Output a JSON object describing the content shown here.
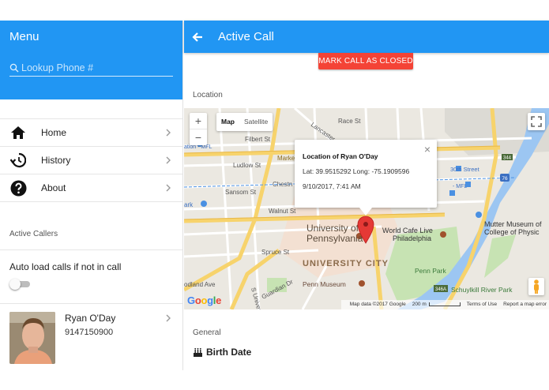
{
  "sidebar": {
    "title": "Menu",
    "search": {
      "placeholder": "Lookup Phone #",
      "value": ""
    },
    "nav": [
      {
        "label": "Home",
        "icon": "home-icon"
      },
      {
        "label": "History",
        "icon": "history-icon"
      },
      {
        "label": "About",
        "icon": "help-icon"
      }
    ],
    "active_callers_label": "Active Callers",
    "auto_load_label": "Auto load calls if not in call",
    "auto_load_enabled": false,
    "callers": [
      {
        "name": "Ryan O'Day",
        "phone": "9147150900"
      }
    ]
  },
  "main": {
    "back_icon": "arrow-left-icon",
    "title": "Active Call",
    "close_button": "MARK CALL AS CLOSED",
    "location_label": "Location",
    "map": {
      "map_button": "Map",
      "satellite_button": "Satellite",
      "zoom_in": "+",
      "zoom_out": "−",
      "info": {
        "title": "Location of Ryan O'Day",
        "coords": "Lat: 39.9515292 Long: -75.1909596",
        "datetime": "9/10/2017, 7:41 AM",
        "close": "×"
      },
      "labels": {
        "filbert": "Filbert St",
        "ludlow": "Ludlow St",
        "sansom": "Sansom St",
        "walnut": "Walnut St",
        "chestnut": "Chestn",
        "market": "Marke",
        "spruce": "Spruce St",
        "univ_penn_1": "University of",
        "univ_penn_2": "Pennsylvania",
        "univ_city": "UNIVERSITY CITY",
        "penn_museum": "Penn Museum",
        "world_cafe_1": "World Cafe Live",
        "world_cafe_2": "Philadelphia",
        "mutter_1": "Mutter Museum of",
        "mutter_2": "College of Physic",
        "penn_park": "Penn Park",
        "schuylkill": "Schuylkill River Park",
        "thirtieth": "30th Street",
        "mfl_left": "ation - MFL",
        "mfl_right": "- MFL",
        "race": "Race St",
        "lancaster": "Lancaster",
        "woodland": "odland Ave",
        "guardian": "Guardian Dr",
        "s_univ": "S Univers",
        "ark": "ark"
      },
      "shields": {
        "i76": "76",
        "r344": "344",
        "r346a": "346A"
      },
      "google_logo": "Google",
      "attribution": {
        "data": "Map data ©2017 Google",
        "scale": "200 m",
        "terms": "Terms of Use",
        "report": "Report a map error"
      }
    },
    "general_label": "General",
    "birth_date_label": "Birth Date"
  },
  "colors": {
    "primary": "#2196f3",
    "danger": "#f44336",
    "map_bg": "#ebe8e1",
    "road_yellow": "#f7d36c",
    "park_green": "#c7e3b3",
    "river_blue": "#9cc6f2",
    "campus": "#f3e0d2",
    "pin_red": "#e53935"
  }
}
